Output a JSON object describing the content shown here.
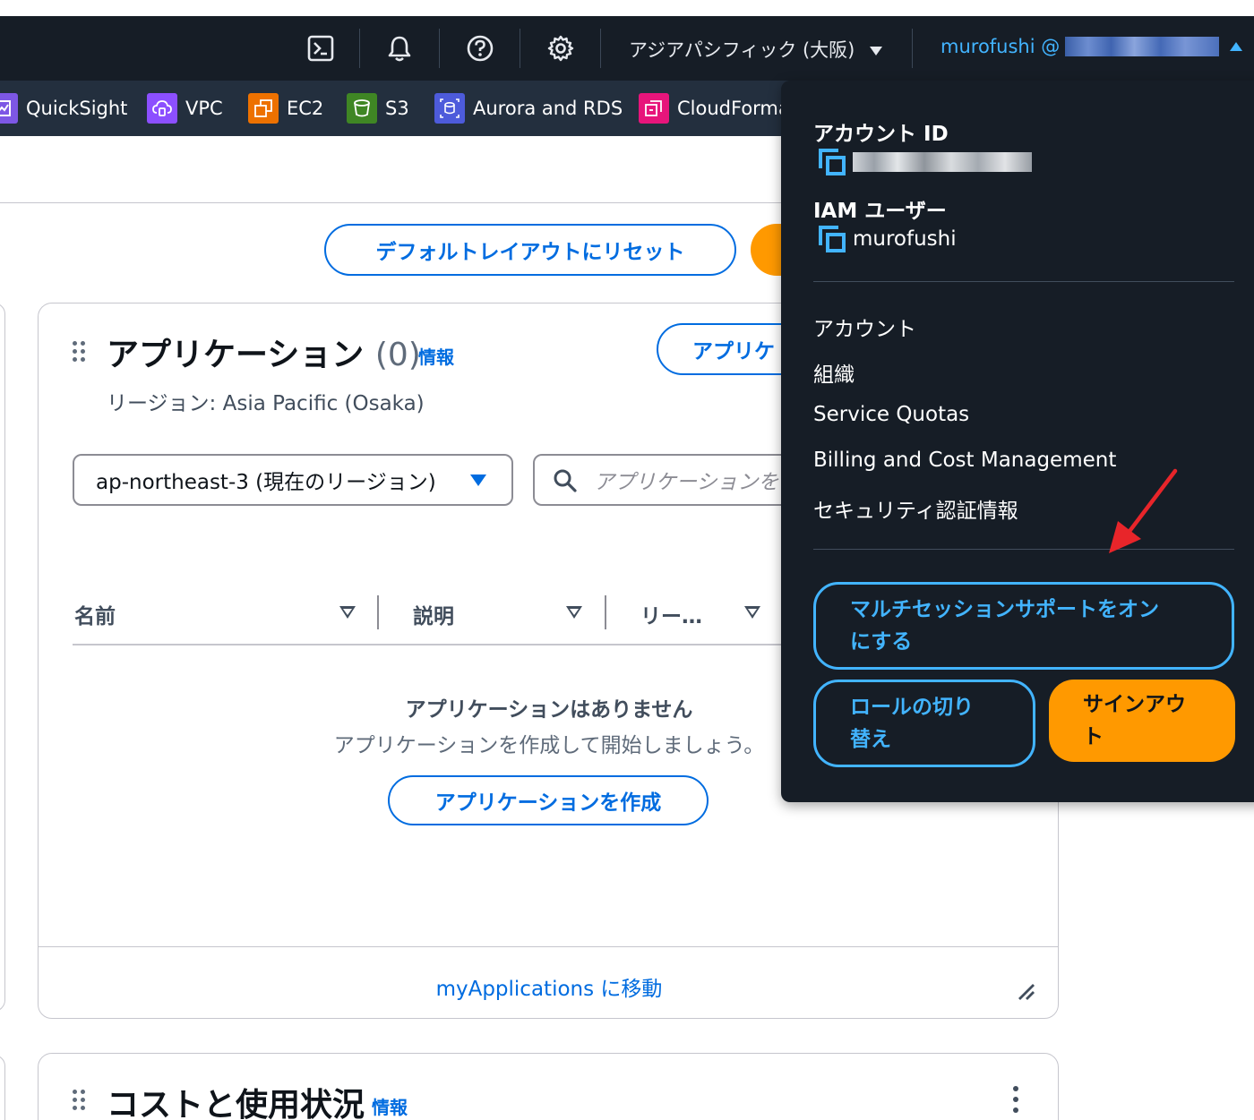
{
  "topnav": {
    "region": "アジアパシフィック (大阪)",
    "user_name": "murofushi @"
  },
  "favorites": [
    {
      "label": "QuickSight",
      "icon": "quicksight-icon",
      "color": "#7d57e5"
    },
    {
      "label": "VPC",
      "icon": "vpc-icon",
      "color": "#8c4fff"
    },
    {
      "label": "EC2",
      "icon": "ec2-icon",
      "color": "#ed7100"
    },
    {
      "label": "S3",
      "icon": "s3-icon",
      "color": "#3f8624"
    },
    {
      "label": "Aurora and RDS",
      "icon": "rds-icon",
      "color": "#4d5bdb"
    },
    {
      "label": "CloudForma",
      "icon": "cloudformation-icon",
      "color": "#e7157b"
    }
  ],
  "page": {
    "reset_layout_label": "デフォルトレイアウトにリセット"
  },
  "applications_widget": {
    "title": "アプリケーション",
    "count": "(0)",
    "info": "情報",
    "create_button_partial": "アプリケ",
    "region_text": "リージョン: Asia Pacific (Osaka)",
    "region_select_value": "ap-northeast-3 (現在のリージョン)",
    "search_placeholder": "アプリケーションを",
    "columns": [
      "名前",
      "説明",
      "リー…"
    ],
    "empty_title": "アプリケーションはありません",
    "empty_desc": "アプリケーションを作成して開始しましょう。",
    "create_button": "アプリケーションを作成",
    "footer_link": "myApplications に移動"
  },
  "cost_widget": {
    "title": "コストと使用状況",
    "info": "情報"
  },
  "account_menu": {
    "account_id_label": "アカウント ID",
    "iam_user_label": "IAM ユーザー",
    "iam_user_value": "murofushi",
    "items": [
      "アカウント",
      "組織",
      "Service Quotas",
      "Billing and Cost Management",
      "セキュリティ認証情報"
    ],
    "multisession_line1": "マルチセッションサポートをオン",
    "multisession_line2": "にする",
    "switch_role_line1": "ロールの切り",
    "switch_role_line2": "替え",
    "sign_out_line1": "サインアウ",
    "sign_out_line2": "ト"
  },
  "colors": {
    "nav_bg": "#161d26",
    "fav_bg": "#232f3e",
    "link_blue": "#006ce0",
    "dark_link_blue": "#42b4ff",
    "primary_orange": "#ff9900",
    "annotation_red": "#e8252a"
  }
}
